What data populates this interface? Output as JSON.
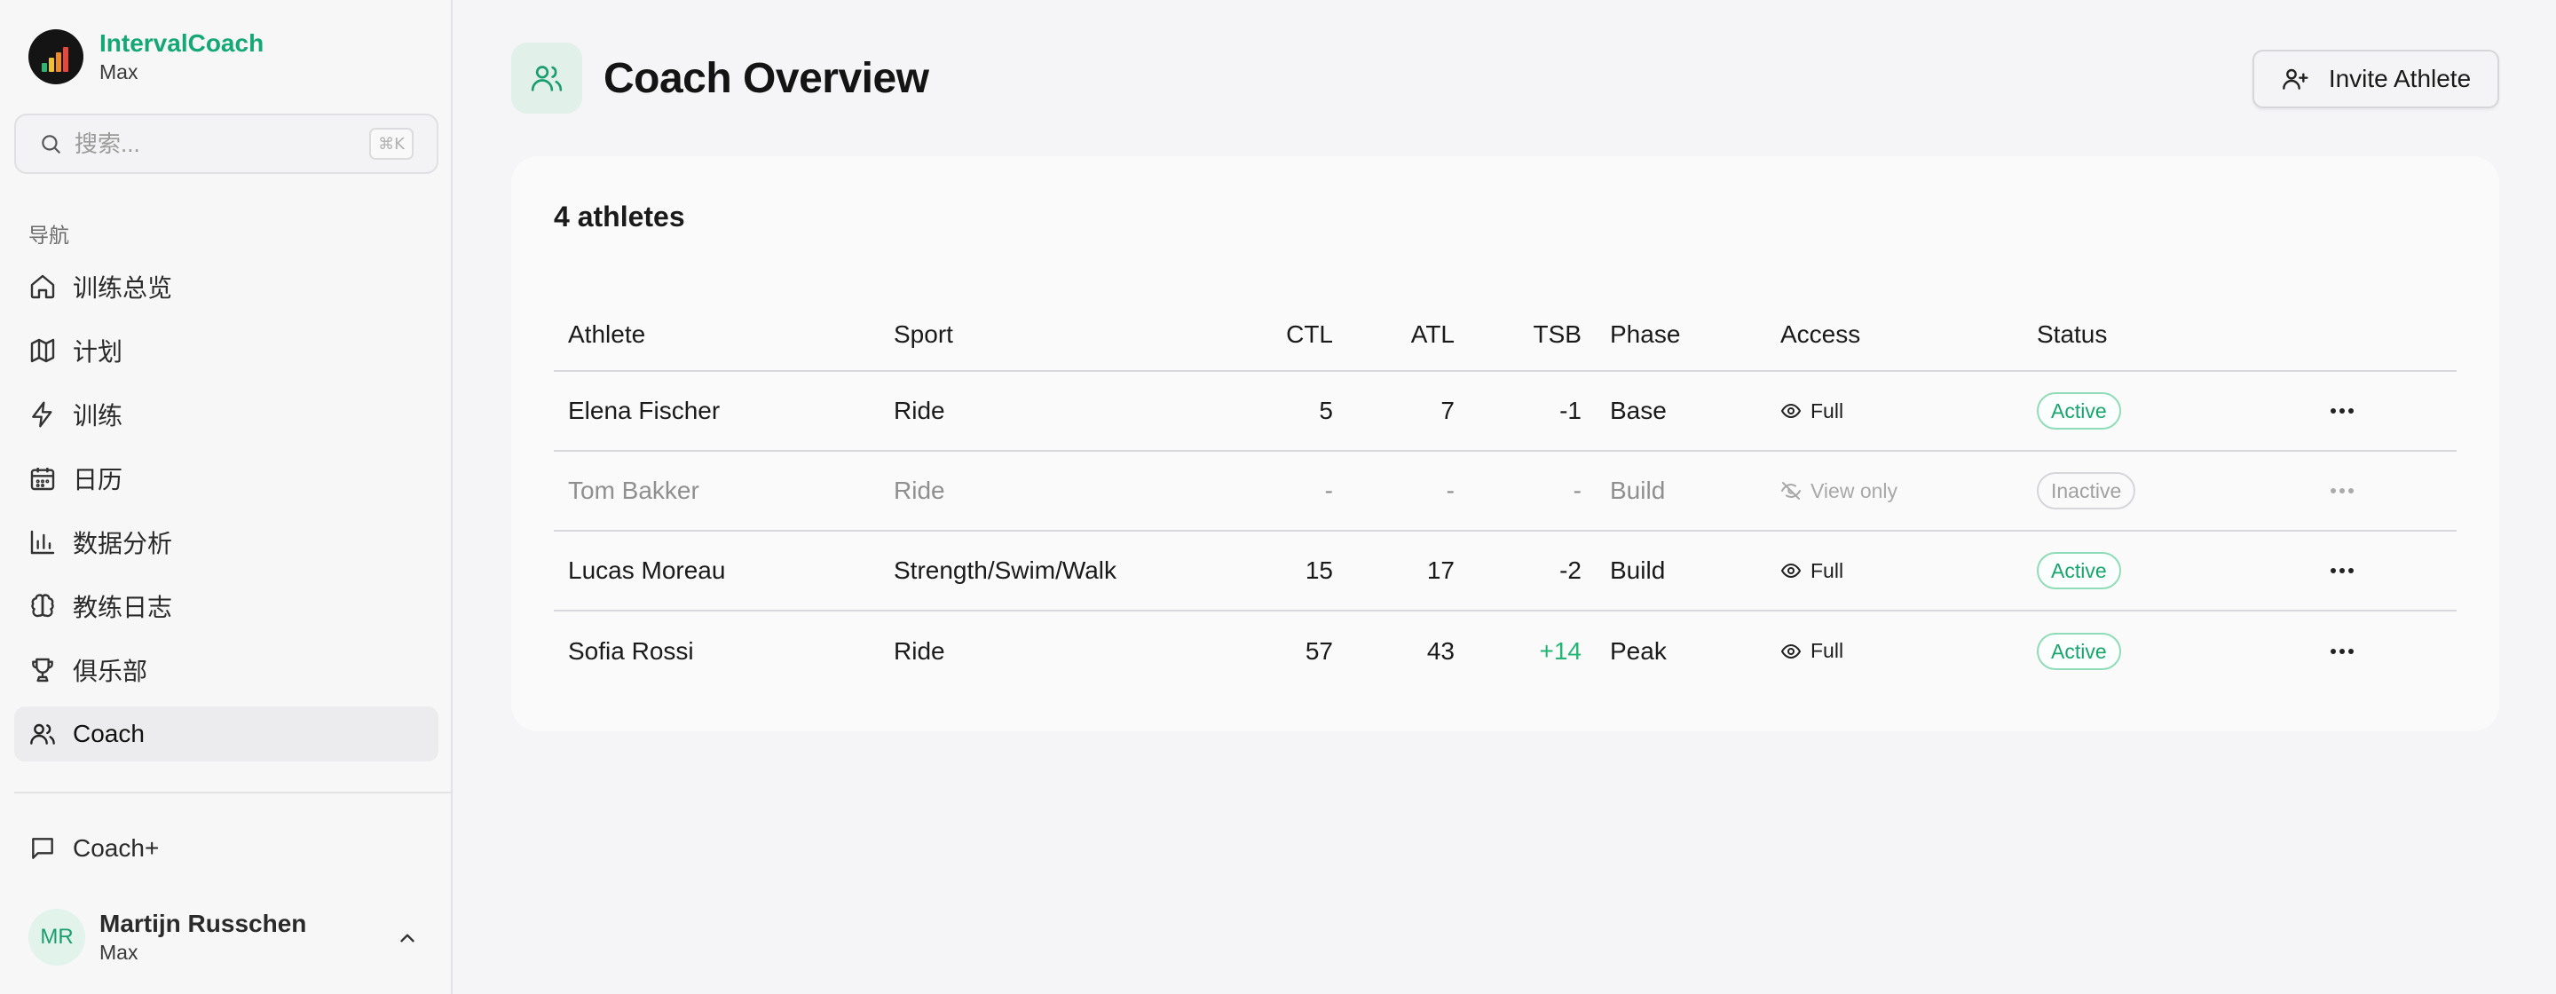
{
  "app": {
    "name": "IntervalCoach",
    "workspace": "Max"
  },
  "search": {
    "placeholder": "搜索...",
    "shortcut": "⌘K"
  },
  "nav": {
    "section_label": "导航",
    "items": [
      {
        "label": "训练总览",
        "icon": "home-icon"
      },
      {
        "label": "计划",
        "icon": "map-icon"
      },
      {
        "label": "训练",
        "icon": "lightning-icon"
      },
      {
        "label": "日历",
        "icon": "calendar-icon"
      },
      {
        "label": "数据分析",
        "icon": "bar-chart-icon"
      },
      {
        "label": "教练日志",
        "icon": "brain-icon"
      },
      {
        "label": "俱乐部",
        "icon": "trophy-icon"
      },
      {
        "label": "Coach",
        "icon": "users-icon",
        "active": true
      }
    ],
    "coach_plus": "Coach+"
  },
  "user": {
    "initials": "MR",
    "name": "Martijn Russchen",
    "workspace": "Max"
  },
  "page": {
    "title": "Coach Overview",
    "invite_label": "Invite Athlete"
  },
  "athletes_card": {
    "title": "4 athletes",
    "columns": [
      "Athlete",
      "Sport",
      "CTL",
      "ATL",
      "TSB",
      "Phase",
      "Access",
      "Status"
    ],
    "rows": [
      {
        "athlete": "Elena Fischer",
        "sport": "Ride",
        "ctl": "5",
        "atl": "7",
        "tsb": "-1",
        "phase": "Base",
        "access": "Full",
        "status": "Active"
      },
      {
        "athlete": "Tom Bakker",
        "sport": "Ride",
        "ctl": "-",
        "atl": "-",
        "tsb": "-",
        "phase": "Build",
        "access": "View only",
        "status": "Inactive"
      },
      {
        "athlete": "Lucas Moreau",
        "sport": "Strength/Swim/Walk",
        "ctl": "15",
        "atl": "17",
        "tsb": "-2",
        "phase": "Build",
        "access": "Full",
        "status": "Active"
      },
      {
        "athlete": "Sofia Rossi",
        "sport": "Ride",
        "ctl": "57",
        "atl": "43",
        "tsb": "+14",
        "phase": "Peak",
        "access": "Full",
        "status": "Active"
      }
    ]
  },
  "colors": {
    "brand": "#15a877",
    "active_badge": "#17a56d",
    "positive_tsb": "#22b573"
  }
}
